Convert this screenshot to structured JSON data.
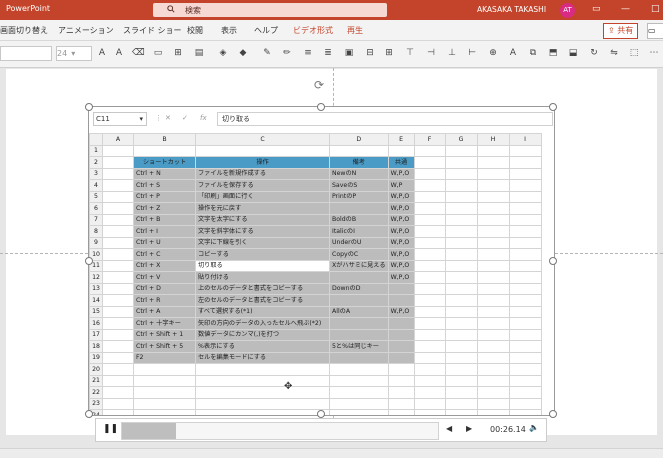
{
  "window": {
    "app_name": "PowerPoint",
    "search_placeholder": "検索",
    "user_name": "AKASAKA TAKASHI",
    "user_initials": "AT"
  },
  "ribbon_tabs": [
    {
      "label": "画面切り替え"
    },
    {
      "label": "アニメーション"
    },
    {
      "label": "スライド ショー"
    },
    {
      "label": "校閲"
    },
    {
      "label": "表示"
    },
    {
      "label": "ヘルプ"
    },
    {
      "label": "ビデオ形式"
    },
    {
      "label": "再生"
    }
  ],
  "share_label": "共有",
  "font_size_value": "24",
  "spreadsheet": {
    "name_box": "C11",
    "formula": "切り取る",
    "columns": [
      "A",
      "B",
      "C",
      "D",
      "E",
      "F",
      "G",
      "H",
      "I"
    ],
    "rows": [
      {
        "n": "1",
        "b": "",
        "c": "",
        "d": "",
        "e": ""
      },
      {
        "n": "2",
        "b": "ショートカット",
        "c": "操作",
        "d": "備考",
        "e": "共通"
      },
      {
        "n": "3",
        "b": "Ctrl + N",
        "c": "ファイルを新規作成する",
        "d": "NewのN",
        "e": "W,P,O"
      },
      {
        "n": "4",
        "b": "Ctrl + S",
        "c": "ファイルを保存する",
        "d": "SaveのS",
        "e": "W,P"
      },
      {
        "n": "5",
        "b": "Ctrl + P",
        "c": "「印刷」画面に行く",
        "d": "PrintのP",
        "e": "W,P,O"
      },
      {
        "n": "6",
        "b": "Ctrl + Z",
        "c": "操作を元に戻す",
        "d": "",
        "e": "W,P,O"
      },
      {
        "n": "7",
        "b": "Ctrl + B",
        "c": "文字を太字にする",
        "d": "BoldのB",
        "e": "W,P,O"
      },
      {
        "n": "8",
        "b": "Ctrl + I",
        "c": "文字を斜字体にする",
        "d": "ItalicのI",
        "e": "W,P,O"
      },
      {
        "n": "9",
        "b": "Ctrl + U",
        "c": "文字に下線を引く",
        "d": "UnderのU",
        "e": "W,P,O"
      },
      {
        "n": "10",
        "b": "Ctrl + C",
        "c": "コピーする",
        "d": "CopyのC",
        "e": "W,P,O"
      },
      {
        "n": "11",
        "b": "Ctrl + X",
        "c": "切り取る",
        "d": "Xがハサミに見える",
        "e": "W,P,O"
      },
      {
        "n": "12",
        "b": "Ctrl + V",
        "c": "貼り付ける",
        "d": "",
        "e": "W,P,O"
      },
      {
        "n": "13",
        "b": "Ctrl + D",
        "c": "上のセルのデータと書式をコピーする",
        "d": "DownのD",
        "e": ""
      },
      {
        "n": "14",
        "b": "Ctrl + R",
        "c": "左のセルのデータと書式をコピーする",
        "d": "",
        "e": ""
      },
      {
        "n": "15",
        "b": "Ctrl + A",
        "c": "すべて選択する(*1)",
        "d": "AllのA",
        "e": "W,P,O"
      },
      {
        "n": "16",
        "b": "Ctrl + 十字キー",
        "c": "矢印の方向のデータの入ったセルへ飛ぶ(*2)",
        "d": "",
        "e": ""
      },
      {
        "n": "17",
        "b": "Ctrl + Shift + 1",
        "c": "数値データにカンマ(,)を打つ",
        "d": "",
        "e": ""
      },
      {
        "n": "18",
        "b": "Ctrl + Shift + 5",
        "c": "%表示にする",
        "d": "5と%は同じキー",
        "e": ""
      },
      {
        "n": "19",
        "b": "F2",
        "c": "セルを編集モードにする",
        "d": "",
        "e": ""
      },
      {
        "n": "20",
        "b": "",
        "c": "",
        "d": "",
        "e": ""
      },
      {
        "n": "21",
        "b": "",
        "c": "",
        "d": "",
        "e": ""
      },
      {
        "n": "22",
        "b": "",
        "c": "",
        "d": "",
        "e": ""
      },
      {
        "n": "23",
        "b": "",
        "c": "",
        "d": "",
        "e": ""
      },
      {
        "n": "24",
        "b": "",
        "c": "",
        "d": "",
        "e": ""
      }
    ]
  },
  "player": {
    "time": "00:26.14",
    "progress_fraction": 0.17
  }
}
